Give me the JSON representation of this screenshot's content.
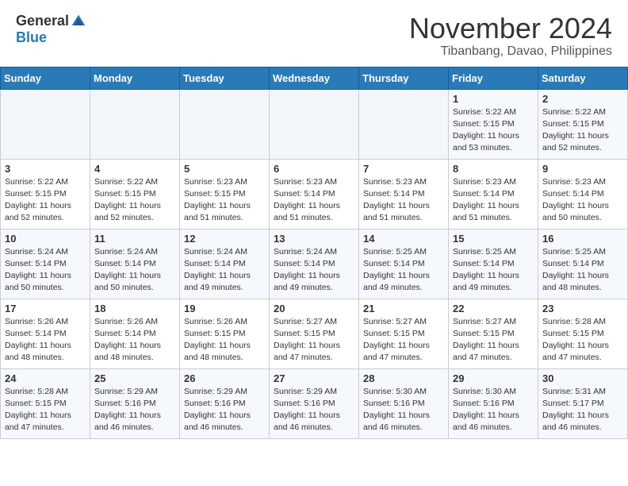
{
  "logo": {
    "general": "General",
    "blue": "Blue"
  },
  "header": {
    "month": "November 2024",
    "location": "Tibanbang, Davao, Philippines"
  },
  "weekdays": [
    "Sunday",
    "Monday",
    "Tuesday",
    "Wednesday",
    "Thursday",
    "Friday",
    "Saturday"
  ],
  "weeks": [
    [
      {
        "day": "",
        "info": ""
      },
      {
        "day": "",
        "info": ""
      },
      {
        "day": "",
        "info": ""
      },
      {
        "day": "",
        "info": ""
      },
      {
        "day": "",
        "info": ""
      },
      {
        "day": "1",
        "info": "Sunrise: 5:22 AM\nSunset: 5:15 PM\nDaylight: 11 hours\nand 53 minutes."
      },
      {
        "day": "2",
        "info": "Sunrise: 5:22 AM\nSunset: 5:15 PM\nDaylight: 11 hours\nand 52 minutes."
      }
    ],
    [
      {
        "day": "3",
        "info": "Sunrise: 5:22 AM\nSunset: 5:15 PM\nDaylight: 11 hours\nand 52 minutes."
      },
      {
        "day": "4",
        "info": "Sunrise: 5:22 AM\nSunset: 5:15 PM\nDaylight: 11 hours\nand 52 minutes."
      },
      {
        "day": "5",
        "info": "Sunrise: 5:23 AM\nSunset: 5:15 PM\nDaylight: 11 hours\nand 51 minutes."
      },
      {
        "day": "6",
        "info": "Sunrise: 5:23 AM\nSunset: 5:14 PM\nDaylight: 11 hours\nand 51 minutes."
      },
      {
        "day": "7",
        "info": "Sunrise: 5:23 AM\nSunset: 5:14 PM\nDaylight: 11 hours\nand 51 minutes."
      },
      {
        "day": "8",
        "info": "Sunrise: 5:23 AM\nSunset: 5:14 PM\nDaylight: 11 hours\nand 51 minutes."
      },
      {
        "day": "9",
        "info": "Sunrise: 5:23 AM\nSunset: 5:14 PM\nDaylight: 11 hours\nand 50 minutes."
      }
    ],
    [
      {
        "day": "10",
        "info": "Sunrise: 5:24 AM\nSunset: 5:14 PM\nDaylight: 11 hours\nand 50 minutes."
      },
      {
        "day": "11",
        "info": "Sunrise: 5:24 AM\nSunset: 5:14 PM\nDaylight: 11 hours\nand 50 minutes."
      },
      {
        "day": "12",
        "info": "Sunrise: 5:24 AM\nSunset: 5:14 PM\nDaylight: 11 hours\nand 49 minutes."
      },
      {
        "day": "13",
        "info": "Sunrise: 5:24 AM\nSunset: 5:14 PM\nDaylight: 11 hours\nand 49 minutes."
      },
      {
        "day": "14",
        "info": "Sunrise: 5:25 AM\nSunset: 5:14 PM\nDaylight: 11 hours\nand 49 minutes."
      },
      {
        "day": "15",
        "info": "Sunrise: 5:25 AM\nSunset: 5:14 PM\nDaylight: 11 hours\nand 49 minutes."
      },
      {
        "day": "16",
        "info": "Sunrise: 5:25 AM\nSunset: 5:14 PM\nDaylight: 11 hours\nand 48 minutes."
      }
    ],
    [
      {
        "day": "17",
        "info": "Sunrise: 5:26 AM\nSunset: 5:14 PM\nDaylight: 11 hours\nand 48 minutes."
      },
      {
        "day": "18",
        "info": "Sunrise: 5:26 AM\nSunset: 5:14 PM\nDaylight: 11 hours\nand 48 minutes."
      },
      {
        "day": "19",
        "info": "Sunrise: 5:26 AM\nSunset: 5:15 PM\nDaylight: 11 hours\nand 48 minutes."
      },
      {
        "day": "20",
        "info": "Sunrise: 5:27 AM\nSunset: 5:15 PM\nDaylight: 11 hours\nand 47 minutes."
      },
      {
        "day": "21",
        "info": "Sunrise: 5:27 AM\nSunset: 5:15 PM\nDaylight: 11 hours\nand 47 minutes."
      },
      {
        "day": "22",
        "info": "Sunrise: 5:27 AM\nSunset: 5:15 PM\nDaylight: 11 hours\nand 47 minutes."
      },
      {
        "day": "23",
        "info": "Sunrise: 5:28 AM\nSunset: 5:15 PM\nDaylight: 11 hours\nand 47 minutes."
      }
    ],
    [
      {
        "day": "24",
        "info": "Sunrise: 5:28 AM\nSunset: 5:15 PM\nDaylight: 11 hours\nand 47 minutes."
      },
      {
        "day": "25",
        "info": "Sunrise: 5:29 AM\nSunset: 5:16 PM\nDaylight: 11 hours\nand 46 minutes."
      },
      {
        "day": "26",
        "info": "Sunrise: 5:29 AM\nSunset: 5:16 PM\nDaylight: 11 hours\nand 46 minutes."
      },
      {
        "day": "27",
        "info": "Sunrise: 5:29 AM\nSunset: 5:16 PM\nDaylight: 11 hours\nand 46 minutes."
      },
      {
        "day": "28",
        "info": "Sunrise: 5:30 AM\nSunset: 5:16 PM\nDaylight: 11 hours\nand 46 minutes."
      },
      {
        "day": "29",
        "info": "Sunrise: 5:30 AM\nSunset: 5:16 PM\nDaylight: 11 hours\nand 46 minutes."
      },
      {
        "day": "30",
        "info": "Sunrise: 5:31 AM\nSunset: 5:17 PM\nDaylight: 11 hours\nand 46 minutes."
      }
    ]
  ]
}
